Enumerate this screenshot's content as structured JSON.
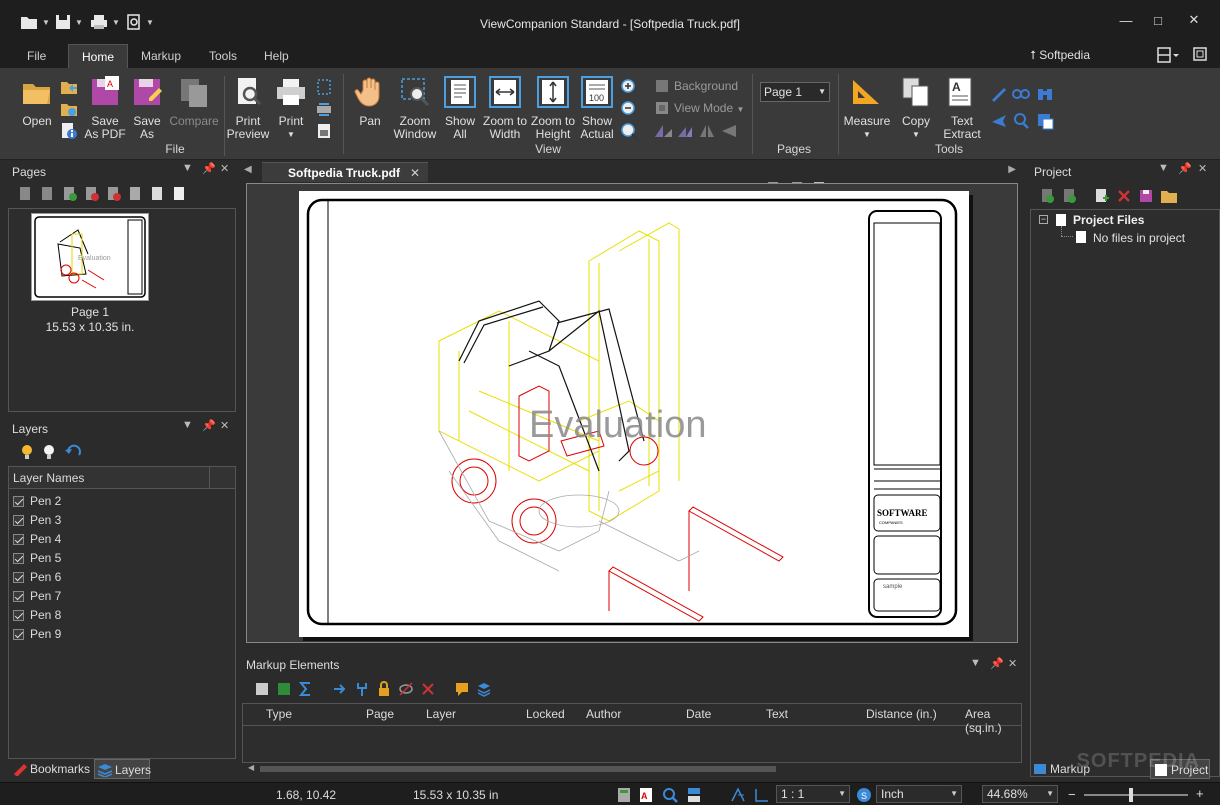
{
  "window": {
    "title": "ViewCompanion Standard - [Softpedia Truck.pdf]",
    "minimize": "—",
    "maximize": "□",
    "close": "✕"
  },
  "ribbon_tabs": [
    {
      "label": "File"
    },
    {
      "label": "Home"
    },
    {
      "label": "Markup"
    },
    {
      "label": "Tools"
    },
    {
      "label": "Help"
    }
  ],
  "user": "⭡ Softpedia",
  "ribbon": {
    "file_group": {
      "label": "File",
      "open": "Open",
      "save_pdf_1": "Save",
      "save_pdf_2": "As PDF",
      "save_as_1": "Save",
      "save_as_2": "As",
      "compare": "Compare",
      "print_preview_1": "Print",
      "print_preview_2": "Preview",
      "print": "Print"
    },
    "view_group": {
      "label": "View",
      "pan": "Pan",
      "zoom_window_1": "Zoom",
      "zoom_window_2": "Window",
      "show_all_1": "Show",
      "show_all_2": "All",
      "zoom_width_1": "Zoom to",
      "zoom_width_2": "Width",
      "zoom_height_1": "Zoom to",
      "zoom_height_2": "Height",
      "show_actual_1": "Show",
      "show_actual_2": "Actual",
      "background": "Background",
      "view_mode": "View Mode"
    },
    "pages_group": {
      "label": "Pages",
      "page_combo": "Page 1"
    },
    "tools_group": {
      "label": "Tools",
      "measure": "Measure",
      "copy": "Copy",
      "text_extract_1": "Text",
      "text_extract_2": "Extract"
    }
  },
  "pages_panel": {
    "title": "Pages",
    "thumb_label": "Page 1",
    "thumb_size": "15.53 x 10.35 in."
  },
  "layers_panel": {
    "title": "Layers",
    "column": "Layer Names",
    "layers": [
      "Pen 2",
      "Pen 3",
      "Pen 4",
      "Pen 5",
      "Pen 6",
      "Pen 7",
      "Pen 8",
      "Pen 9"
    ]
  },
  "document": {
    "tab": "Softpedia Truck.pdf",
    "watermark": "Evaluation",
    "titleblock_logo_1": "SOFTWARE",
    "titleblock_logo_2": "COMPANIES",
    "titleblock_sample": "sample"
  },
  "markup_panel": {
    "title": "Markup Elements",
    "columns": [
      "Type",
      "Page",
      "Layer",
      "Locked",
      "Author",
      "Date",
      "Text",
      "Distance (in.)",
      "Area (sq.in.)"
    ]
  },
  "project_panel": {
    "title": "Project",
    "root": "Project Files",
    "empty": "No files in project"
  },
  "bottom_tabs": {
    "bookmarks": "Bookmarks",
    "layers": "Layers",
    "markup_properties": "Markup Properties",
    "project": "Project"
  },
  "status": {
    "coords": "1.68, 10.42",
    "size": "15.53 x 10.35 in",
    "scale": "1 : 1",
    "units": "Inch",
    "zoom": "44.68%",
    "zoom_level": 0.45
  },
  "watermark_brand": "SOFTPEDIA"
}
